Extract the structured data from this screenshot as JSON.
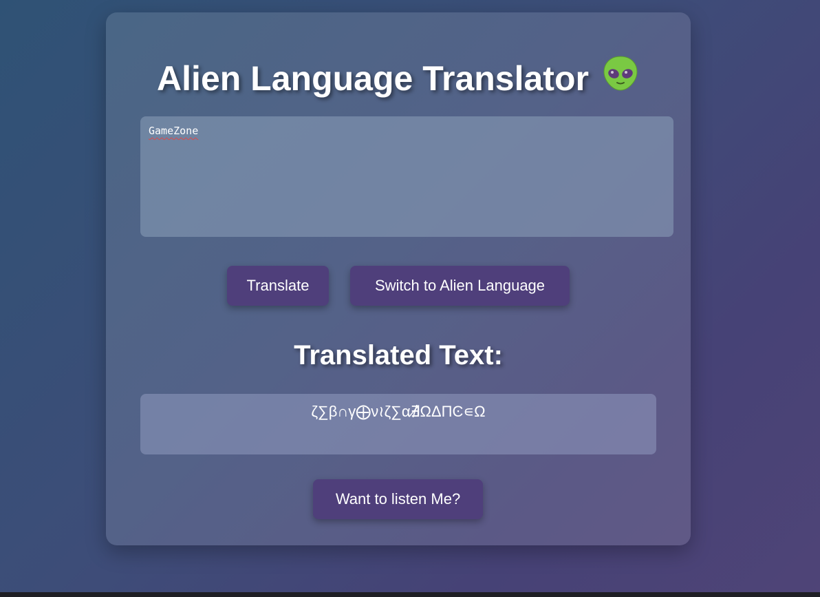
{
  "header": {
    "title": "Alien Language Translator",
    "title_icon": "alien-emoji-icon"
  },
  "input": {
    "value": "GameZone"
  },
  "buttons": {
    "translate_label": "Translate",
    "switch_label": "Switch to Alien Language",
    "listen_label": "Want to listen Me?"
  },
  "result": {
    "heading": "Translated Text:",
    "text": "ζ∑β∩γ⨁ν≀ζ∑α∄̸ΩΔΠϾ∊Ω"
  },
  "colors": {
    "button": "#4f3f7b",
    "text": "#ffffff",
    "alien_green": "#7ac943"
  }
}
